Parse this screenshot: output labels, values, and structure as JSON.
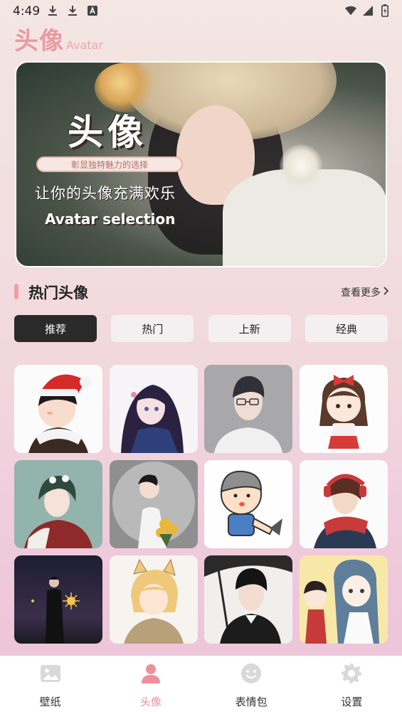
{
  "status_bar": {
    "time": "4:49"
  },
  "app_title": {
    "cn": "头像",
    "en": "Avatar"
  },
  "banner": {
    "title": "头像",
    "tagline": "彰显独特魅力的选择",
    "subtitle": "让你的头像充满欢乐",
    "english": "Avatar selection"
  },
  "section": {
    "title": "热门头像",
    "see_more": "查看更多"
  },
  "tabs": [
    {
      "label": "推荐",
      "active": true
    },
    {
      "label": "热门",
      "active": false
    },
    {
      "label": "上新",
      "active": false
    },
    {
      "label": "经典",
      "active": false
    }
  ],
  "bottom_nav": [
    {
      "label": "壁纸",
      "icon": "image-icon",
      "active": false
    },
    {
      "label": "头像",
      "icon": "person-icon",
      "active": true
    },
    {
      "label": "表情包",
      "icon": "smiley-icon",
      "active": false
    },
    {
      "label": "设置",
      "icon": "gear-icon",
      "active": false
    }
  ],
  "colors": {
    "accent": "#ee8f99",
    "active_tab": "#2a2a2a"
  }
}
